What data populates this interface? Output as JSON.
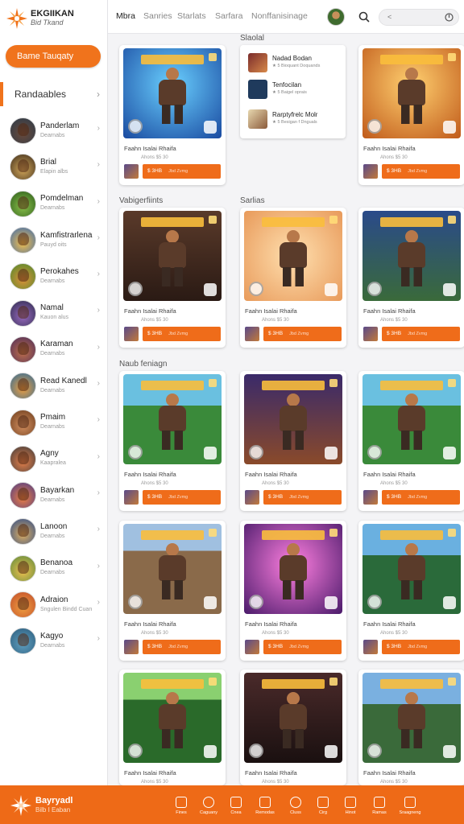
{
  "brand": {
    "title": "EKGIIKAN",
    "subtitle": "Bid Tkand"
  },
  "home_button": "Bame Tauqaty",
  "sidebar": {
    "section_label": "Randaables",
    "items": [
      {
        "name": "Panderlam",
        "sub": "Dearnabs"
      },
      {
        "name": "Brial",
        "sub": "Elapin albs"
      },
      {
        "name": "Pomdelman",
        "sub": "Dearnabs"
      },
      {
        "name": "Kamfistrarlena",
        "sub": "Pauyd oits"
      },
      {
        "name": "Perokahes",
        "sub": "Dearnabs"
      },
      {
        "name": "Namal",
        "sub": "Kauon alus"
      },
      {
        "name": "Karaman",
        "sub": "Dearnabs"
      },
      {
        "name": "Read Kanedl",
        "sub": "Dearnabs"
      },
      {
        "name": "Pmaim",
        "sub": "Dearnabs"
      },
      {
        "name": "Agny",
        "sub": "Kaapralea"
      },
      {
        "name": "Bayarkan",
        "sub": "Dearnabs"
      },
      {
        "name": "Lanoon",
        "sub": "Dearnabs"
      },
      {
        "name": "Benanoa",
        "sub": "Dearnabs"
      },
      {
        "name": "Adraion",
        "sub": "Sngulen Bindd Cuan"
      },
      {
        "name": "Kagyo",
        "sub": "Dearnabs"
      }
    ]
  },
  "topbar": {
    "tabs": [
      "Mbra",
      "Sanries",
      "Starlats",
      "Sarfara",
      "Nonffanisinage"
    ],
    "search_value": "<"
  },
  "sections": {
    "featured": "Slaolal",
    "bestsellers": "Vabigerfiints",
    "sales": "Sarlias",
    "new": "Naub feniagn"
  },
  "list": [
    {
      "name": "Nadad Bodan",
      "meta": "★ 5 Bioquant Doquands"
    },
    {
      "name": "Tenfocilan",
      "meta": "★ 5 Baigel oprais"
    },
    {
      "name": "Rarptyfrelc Molr",
      "meta": "★ 5 Besigan f Dnguals"
    }
  ],
  "card": {
    "title": "Faahn Isalai Rhaifa",
    "price": "Ahons $5 30",
    "cta": "$ 3HB",
    "cta_sub": "Jbd Zvmg"
  },
  "bottombar": {
    "title": "Bayryadl",
    "subtitle": "Bilb I Eaban",
    "items": [
      "Fines",
      "Caguany",
      "Cnea",
      "Remodas",
      "Cluss",
      "Cirg",
      "Hinot",
      "Ramas",
      "Sraagneng"
    ]
  },
  "colors": {
    "accent": "#ee6a17",
    "accent_light": "#f0731c"
  }
}
